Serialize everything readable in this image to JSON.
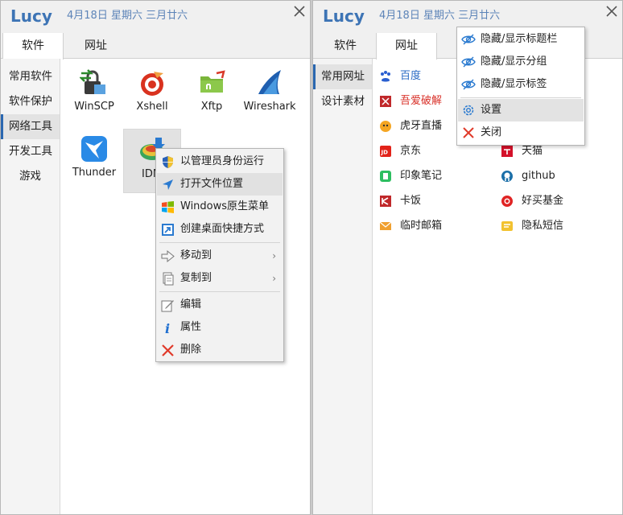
{
  "left": {
    "title": "Lucy",
    "date": "4月18日 星期六  三月廿六",
    "tabs": [
      {
        "label": "软件"
      },
      {
        "label": "网址"
      }
    ],
    "sidebar": [
      {
        "label": "常用软件"
      },
      {
        "label": "软件保护"
      },
      {
        "label": "网络工具"
      },
      {
        "label": "开发工具"
      },
      {
        "label": "游戏"
      }
    ],
    "apps": [
      {
        "label": "WinSCP",
        "icon": "winscp-icon"
      },
      {
        "label": "Xshell",
        "icon": "xshell-icon"
      },
      {
        "label": "Xftp",
        "icon": "xftp-icon"
      },
      {
        "label": "Wireshark",
        "icon": "wireshark-icon"
      },
      {
        "label": "Thunder",
        "icon": "thunder-icon"
      },
      {
        "label": "IDM",
        "icon": "idm-icon"
      }
    ],
    "context_menu": [
      {
        "label": "以管理员身份运行",
        "icon": "shield-icon"
      },
      {
        "label": "打开文件位置",
        "icon": "navigate-arrow-icon"
      },
      {
        "label": "Windows原生菜单",
        "icon": "windows-logo-icon"
      },
      {
        "label": "创建桌面快捷方式",
        "icon": "shortcut-icon"
      },
      {
        "label": "移动到",
        "icon": "move-arrow-icon"
      },
      {
        "label": "复制到",
        "icon": "copy-document-icon"
      },
      {
        "label": "编辑",
        "icon": "edit-icon"
      },
      {
        "label": "属性",
        "icon": "info-icon"
      },
      {
        "label": "删除",
        "icon": "delete-x-icon"
      }
    ]
  },
  "right": {
    "title": "Lucy",
    "date": "4月18日 星期六  三月廿六",
    "tabs": [
      {
        "label": "软件"
      },
      {
        "label": "网址"
      }
    ],
    "sidebar": [
      {
        "label": "常用网址"
      },
      {
        "label": "设计素材"
      }
    ],
    "links": [
      {
        "label": "百度",
        "icon": "baidu-icon"
      },
      {
        "label": "吾爱破解",
        "icon": "52pojie-icon"
      },
      {
        "label": "虎牙直播",
        "icon": "huya-icon"
      },
      {
        "label": "京东",
        "icon": "jd-icon"
      },
      {
        "label": "印象笔记",
        "icon": "evernote-icon"
      },
      {
        "label": "卡饭",
        "icon": "kafan-icon"
      },
      {
        "label": "临时邮箱",
        "icon": "mail-icon"
      },
      {
        "label": "天猫",
        "icon": "tmall-icon"
      },
      {
        "label": "github",
        "icon": "github-icon"
      },
      {
        "label": "好买基金",
        "icon": "howbuy-icon"
      },
      {
        "label": "隐私短信",
        "icon": "sms-icon"
      }
    ],
    "dropdown": [
      {
        "label": "隐藏/显示标题栏",
        "icon": "eye-hidden-icon"
      },
      {
        "label": "隐藏/显示分组",
        "icon": "eye-hidden-icon"
      },
      {
        "label": "隐藏/显示标签",
        "icon": "eye-hidden-icon"
      },
      {
        "label": "设置",
        "icon": "gear-icon"
      },
      {
        "label": "关闭",
        "icon": "close-icon"
      }
    ]
  },
  "colors": {
    "title": "#3d74b5",
    "date": "#5d84b8",
    "accent": "#2a67b0",
    "link_blue": "#2a6bc4",
    "link_red": "#d9322a"
  }
}
